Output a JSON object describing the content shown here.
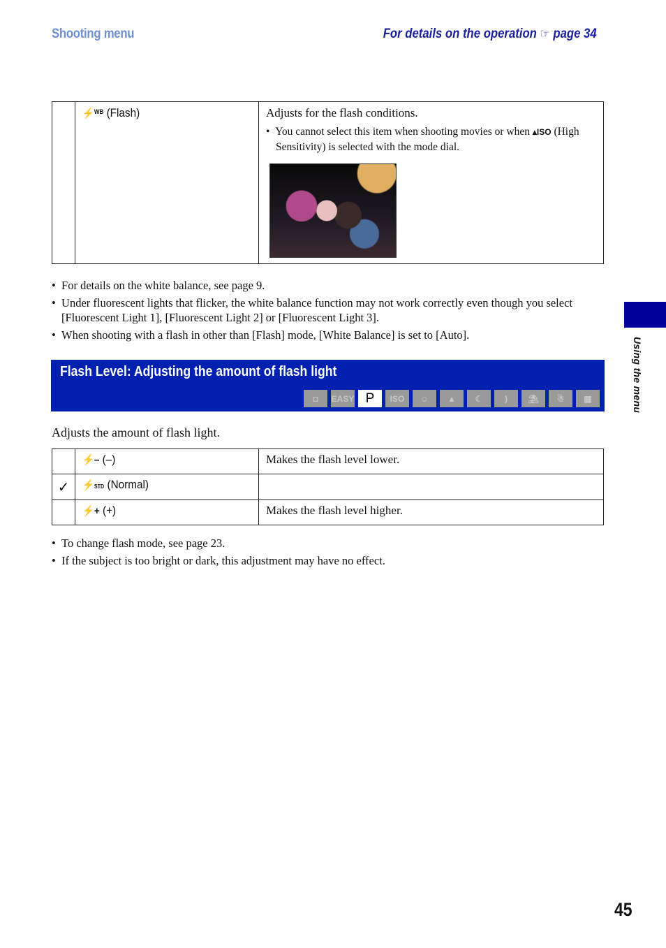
{
  "header": {
    "section": "Shooting menu",
    "reference_prefix": "For details on the operation",
    "reference_icon": "pointing-hand-icon",
    "reference_page": "page 34"
  },
  "wb_table": {
    "rows": [
      {
        "icon": "flash-wb-icon",
        "icon_symbol": "⚡",
        "icon_sup": "WB",
        "label": "(Flash)",
        "description": "Adjusts for the flash conditions.",
        "bullet_before_icon": "You cannot select this item when shooting movies or when",
        "bullet_icon": "high-sensitivity-iso-icon",
        "bullet_icon_text": "ISO",
        "bullet_after_icon": "(High Sensitivity) is selected with the mode dial.",
        "image": "night-scene-flash-photo"
      }
    ]
  },
  "wb_notes": [
    "For details on the white balance, see page 9.",
    "Under fluorescent lights that flicker, the white balance function may not work correctly even though you select [Fluorescent Light 1], [Fluorescent Light 2] or [Fluorescent Light 3].",
    "When shooting with a flash in other than [Flash] mode, [White Balance] is set to [Auto]."
  ],
  "section": {
    "title": "Flash Level: Adjusting the amount of flash light",
    "colors": {
      "band": "#0020b0",
      "mode_inactive": "#9a9a9a",
      "mode_active": "#ffffff"
    },
    "modes": [
      {
        "name": "auto-camera",
        "label": "◘",
        "active": false
      },
      {
        "name": "easy",
        "label": "EASY",
        "active": false
      },
      {
        "name": "program",
        "label": "P",
        "active": true
      },
      {
        "name": "high-sensitivity",
        "label": "ISO",
        "active": false
      },
      {
        "name": "soft-snap",
        "label": "☺",
        "active": false
      },
      {
        "name": "landscape",
        "label": "▲",
        "active": false
      },
      {
        "name": "twilight-portrait",
        "label": "☾",
        "active": false
      },
      {
        "name": "twilight",
        "label": ")",
        "active": false
      },
      {
        "name": "beach",
        "label": "⛱",
        "active": false
      },
      {
        "name": "snow",
        "label": "☃",
        "active": false
      },
      {
        "name": "movie",
        "label": "▦",
        "active": false
      }
    ],
    "intro": "Adjusts the amount of flash light."
  },
  "flash_table": {
    "rows": [
      {
        "default": false,
        "icon": "flash-minus-icon",
        "icon_sub": "–",
        "label": "(–)",
        "description": "Makes the flash level lower."
      },
      {
        "default": true,
        "icon": "flash-std-icon",
        "icon_sub": "STD",
        "label": "(Normal)",
        "description": ""
      },
      {
        "default": false,
        "icon": "flash-plus-icon",
        "icon_sub": "+",
        "label": "(+)",
        "description": "Makes the flash level higher."
      }
    ],
    "default_mark": "✓"
  },
  "flash_notes": [
    "To change flash mode, see page 23.",
    "If the subject is too bright or dark, this adjustment may have no effect."
  ],
  "side_tab": {
    "label": "Using the menu",
    "color": "#00009a"
  },
  "page_number": "45"
}
